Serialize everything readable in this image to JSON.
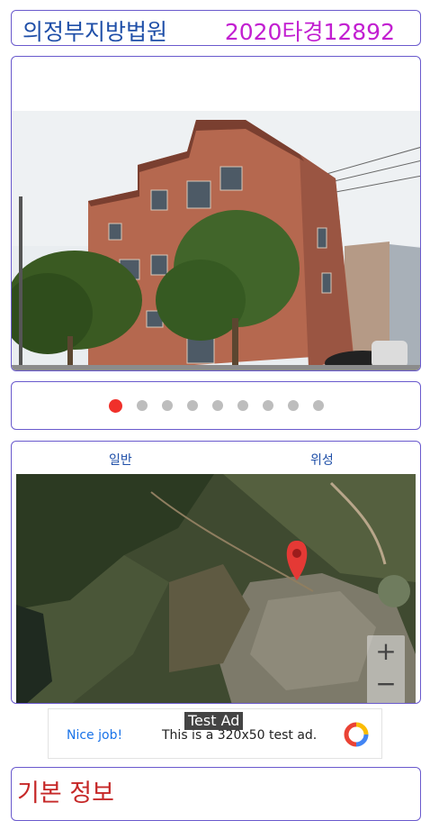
{
  "header": {
    "court": "의정부지방법원",
    "case_number": "2020타경12892"
  },
  "gallery": {
    "total": 9,
    "active_index": 0
  },
  "map": {
    "tab_normal": "일반",
    "tab_satellite": "위성",
    "zoom_in": "+",
    "zoom_out": "−"
  },
  "ad": {
    "tag": "Test Ad",
    "cta": "Nice job!",
    "text": "This is a 320x50 test ad."
  },
  "info": {
    "title": "기본 정보"
  },
  "colors": {
    "border": "#6a5acd",
    "court": "#1f4fa8",
    "case": "#c21fd1",
    "dot_active": "#f0302a",
    "dot": "#bdbdbd",
    "info_title": "#c62828"
  }
}
